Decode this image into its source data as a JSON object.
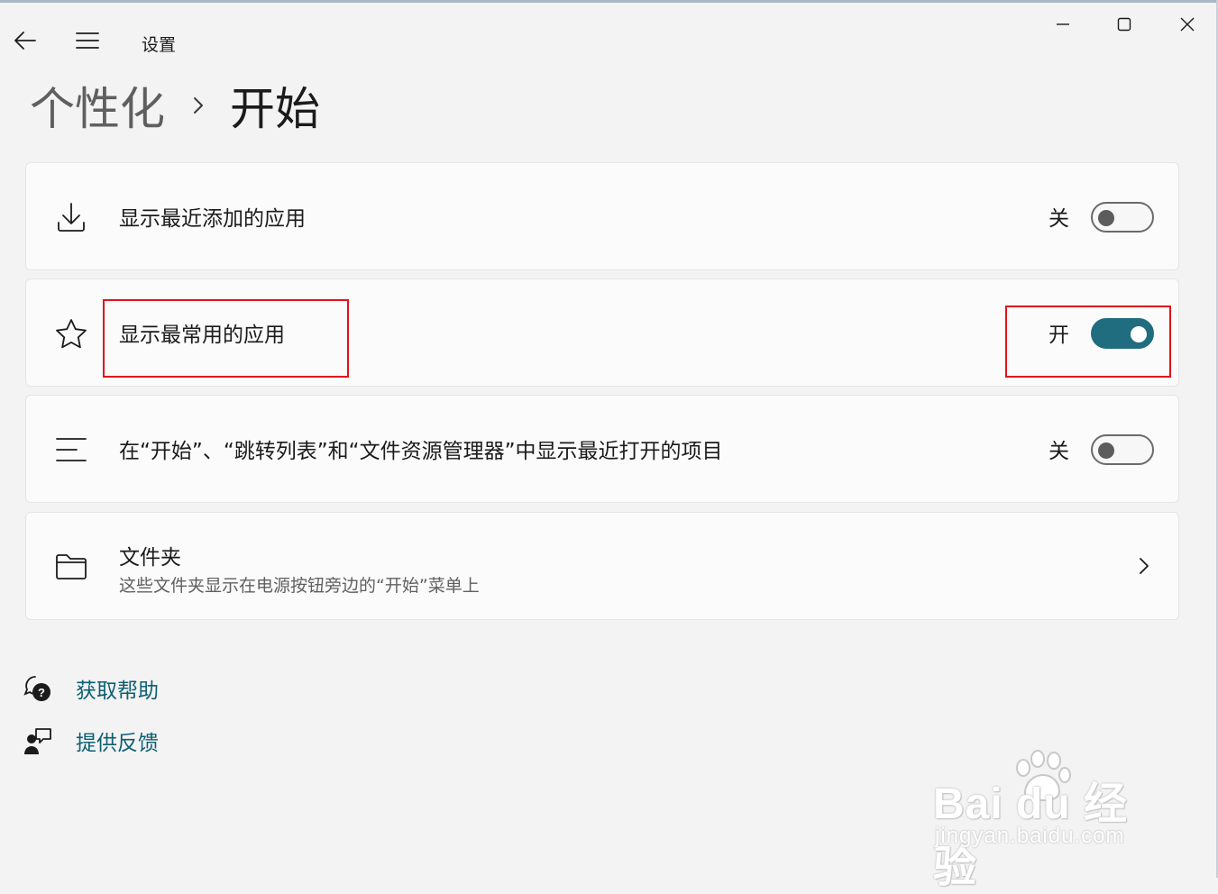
{
  "window": {
    "title": "设置",
    "controls": {
      "minimize": "minimize-icon",
      "maximize": "maximize-icon",
      "close": "close-icon"
    }
  },
  "nav": {
    "back": "back-arrow-icon",
    "menu": "hamburger-menu-icon"
  },
  "breadcrumb": {
    "parent": "个性化",
    "separator": "chevron-right-icon",
    "current": "开始"
  },
  "settings": [
    {
      "icon": "download-icon",
      "label": "显示最近添加的应用",
      "state_text": "关",
      "on": false
    },
    {
      "icon": "star-icon",
      "label": "显示最常用的应用",
      "state_text": "开",
      "on": true
    },
    {
      "icon": "list-icon",
      "label": "在“开始”、“跳转列表”和“文件资源管理器”中显示最近打开的项目",
      "state_text": "关",
      "on": false
    }
  ],
  "folders": {
    "icon": "folder-icon",
    "title": "文件夹",
    "description": "这些文件夹显示在电源按钮旁边的“开始”菜单上"
  },
  "links": [
    {
      "icon": "help-icon",
      "label": "获取帮助"
    },
    {
      "icon": "feedback-icon",
      "label": "提供反馈"
    }
  ],
  "watermark": {
    "main": "Bai du 经验",
    "sub": "jingyan.baidu.com"
  },
  "colors": {
    "accent": "#1f6d7e",
    "link": "#0d5f72",
    "highlight": "#e0131b"
  }
}
